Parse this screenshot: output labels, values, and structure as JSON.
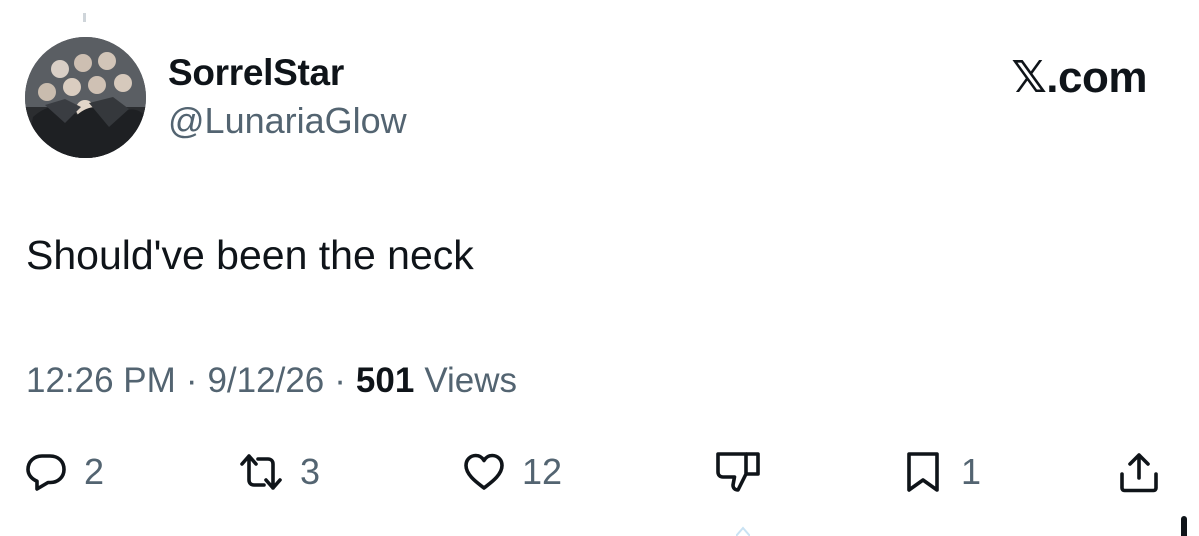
{
  "user": {
    "display_name": "SorrelStar",
    "handle": "@LunariaGlow",
    "avatar_icon": "group-photo-avatar"
  },
  "brand": {
    "label": "𝕏.com"
  },
  "tweet": {
    "text": "Should've been the neck"
  },
  "meta": {
    "time": "12:26 PM",
    "separator": "·",
    "date": "9/12/26",
    "views_count": "501",
    "views_label": "Views"
  },
  "actions": {
    "reply": {
      "icon": "reply-icon",
      "count": "2"
    },
    "repost": {
      "icon": "repost-icon",
      "count": "3"
    },
    "like": {
      "icon": "heart-icon",
      "count": "12"
    },
    "dislike": {
      "icon": "thumbs-down-icon"
    },
    "bookmark": {
      "icon": "bookmark-icon",
      "count": "1"
    },
    "share": {
      "icon": "share-icon"
    }
  },
  "colors": {
    "text_primary": "#0f1419",
    "text_secondary": "#536471",
    "background": "#ffffff"
  }
}
